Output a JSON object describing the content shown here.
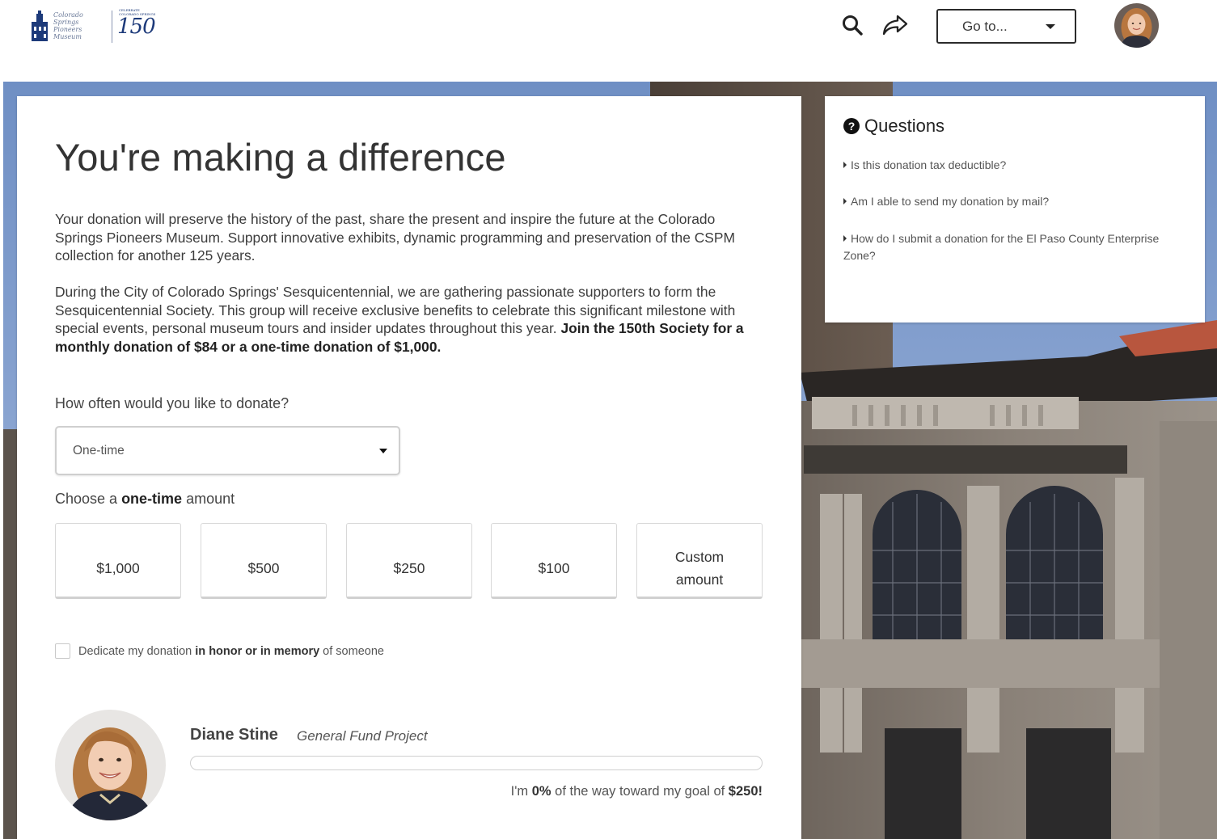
{
  "header": {
    "logo_script": "Colorado Springs Pioneers Museum",
    "logo_number": "150",
    "logo_small_text": "CELEBRATE COLORADO SPRINGS",
    "search_icon": "search-icon",
    "share_icon": "share-icon",
    "goto_label": "Go to..."
  },
  "main": {
    "title": "You're making a difference",
    "paragraph1": "Your donation will preserve the history of the past, share the present and inspire the future at the Colorado Springs Pioneers Museum. Support innovative exhibits, dynamic programming and preservation of the CSPM collection for another 125 years.",
    "paragraph2": "During the City of Colorado Springs' Sesquicentennial, we are gathering passionate supporters to form the Sesquicentennial Society. This group will receive exclusive benefits to celebrate this significant milestone with special events, personal museum tours and insider updates throughout this year. ",
    "paragraph2_bold": "Join the 150th Society for a monthly donation of $84 or a one-time donation of $1,000.",
    "frequency_label": "How often would you like to donate?",
    "frequency_value": "One-time",
    "amount_label_pre": "Choose a ",
    "amount_label_bold": "one-time",
    "amount_label_post": " amount",
    "amounts": [
      "$1,000",
      "$500",
      "$250",
      "$100",
      "Custom amount"
    ],
    "dedicate_pre": "Dedicate my donation ",
    "dedicate_bold": "in honor or in memory",
    "dedicate_post": " of someone"
  },
  "fundraiser": {
    "name": "Diane Stine",
    "project": "General Fund Project",
    "goal_pre": "I'm ",
    "percent": "0%",
    "goal_mid": " of the way toward my goal of ",
    "goal": "$250!",
    "progress_fraction": 0
  },
  "questions": {
    "title": "Questions",
    "items": [
      "Is this donation tax deductible?",
      "Am I able to send my donation by mail?",
      "How do I submit a donation for the El Paso County Enterprise Zone?"
    ]
  },
  "colors": {
    "accent": "#4a7fc1",
    "text": "#3b3b3b",
    "border": "#d0d0d0"
  }
}
